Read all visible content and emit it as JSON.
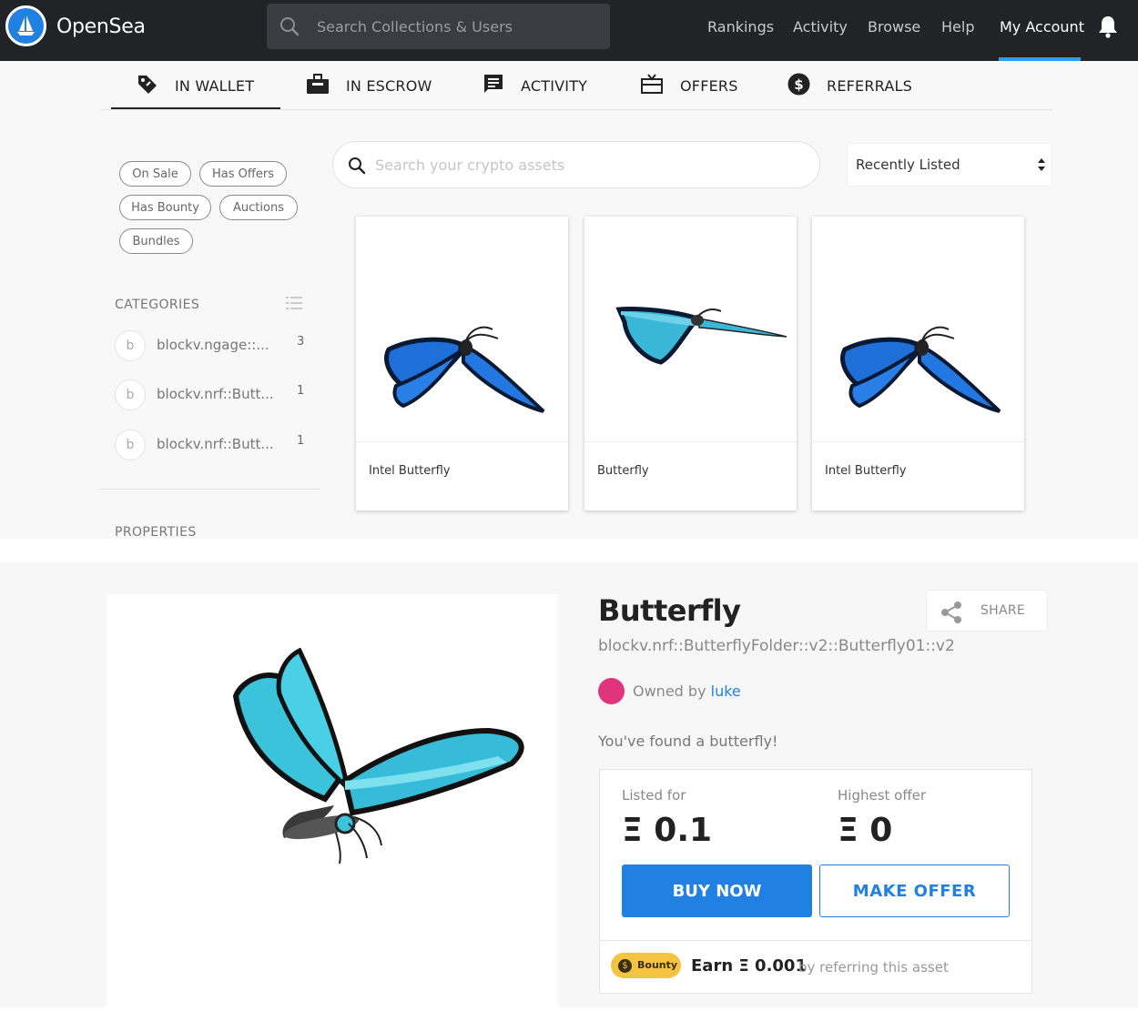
{
  "header": {
    "brand": "OpenSea",
    "search_placeholder": "Search Collections & Users",
    "nav": [
      "Rankings",
      "Activity",
      "Browse",
      "Help",
      "My Account"
    ]
  },
  "tabs": [
    "IN WALLET",
    "IN ESCROW",
    "ACTIVITY",
    "OFFERS",
    "REFERRALS"
  ],
  "filters": [
    "On Sale",
    "Has Offers",
    "Has Bounty",
    "Auctions",
    "Bundles"
  ],
  "categories": {
    "title": "CATEGORIES",
    "items": [
      {
        "badge": "b",
        "name": "blockv.ngage::...",
        "count": "3"
      },
      {
        "badge": "b",
        "name": "blockv.nrf::Butt...",
        "count": "1"
      },
      {
        "badge": "b",
        "name": "blockv.nrf::Butt...",
        "count": "1"
      }
    ]
  },
  "properties_title": "PROPERTIES",
  "asset_search_placeholder": "Search your crypto assets",
  "sort": {
    "selected": "Recently Listed"
  },
  "cards": [
    {
      "title": "Intel Butterfly"
    },
    {
      "title": "Butterfly"
    },
    {
      "title": "Intel Butterfly"
    }
  ],
  "detail": {
    "title": "Butterfly",
    "path": "blockv.nrf::ButterflyFolder::v2::Butterfly01::v2",
    "share_label": "SHARE",
    "owned_by_label": "Owned by",
    "owner": "luke",
    "description": "You've found a butterfly!",
    "listed_for_label": "Listed for",
    "listed_price": "Ξ 0.1",
    "highest_offer_label": "Highest offer",
    "highest_offer": "Ξ 0",
    "buy_now_label": "BUY NOW",
    "make_offer_label": "MAKE OFFER",
    "bounty_label": "Bounty",
    "earn_text": "Earn Ξ 0.001",
    "earn_sub": "by referring this asset"
  },
  "colors": {
    "accent": "#2081e2",
    "navbar": "#222327",
    "bounty": "#f5c342",
    "owner_avatar": "#e0347f"
  }
}
